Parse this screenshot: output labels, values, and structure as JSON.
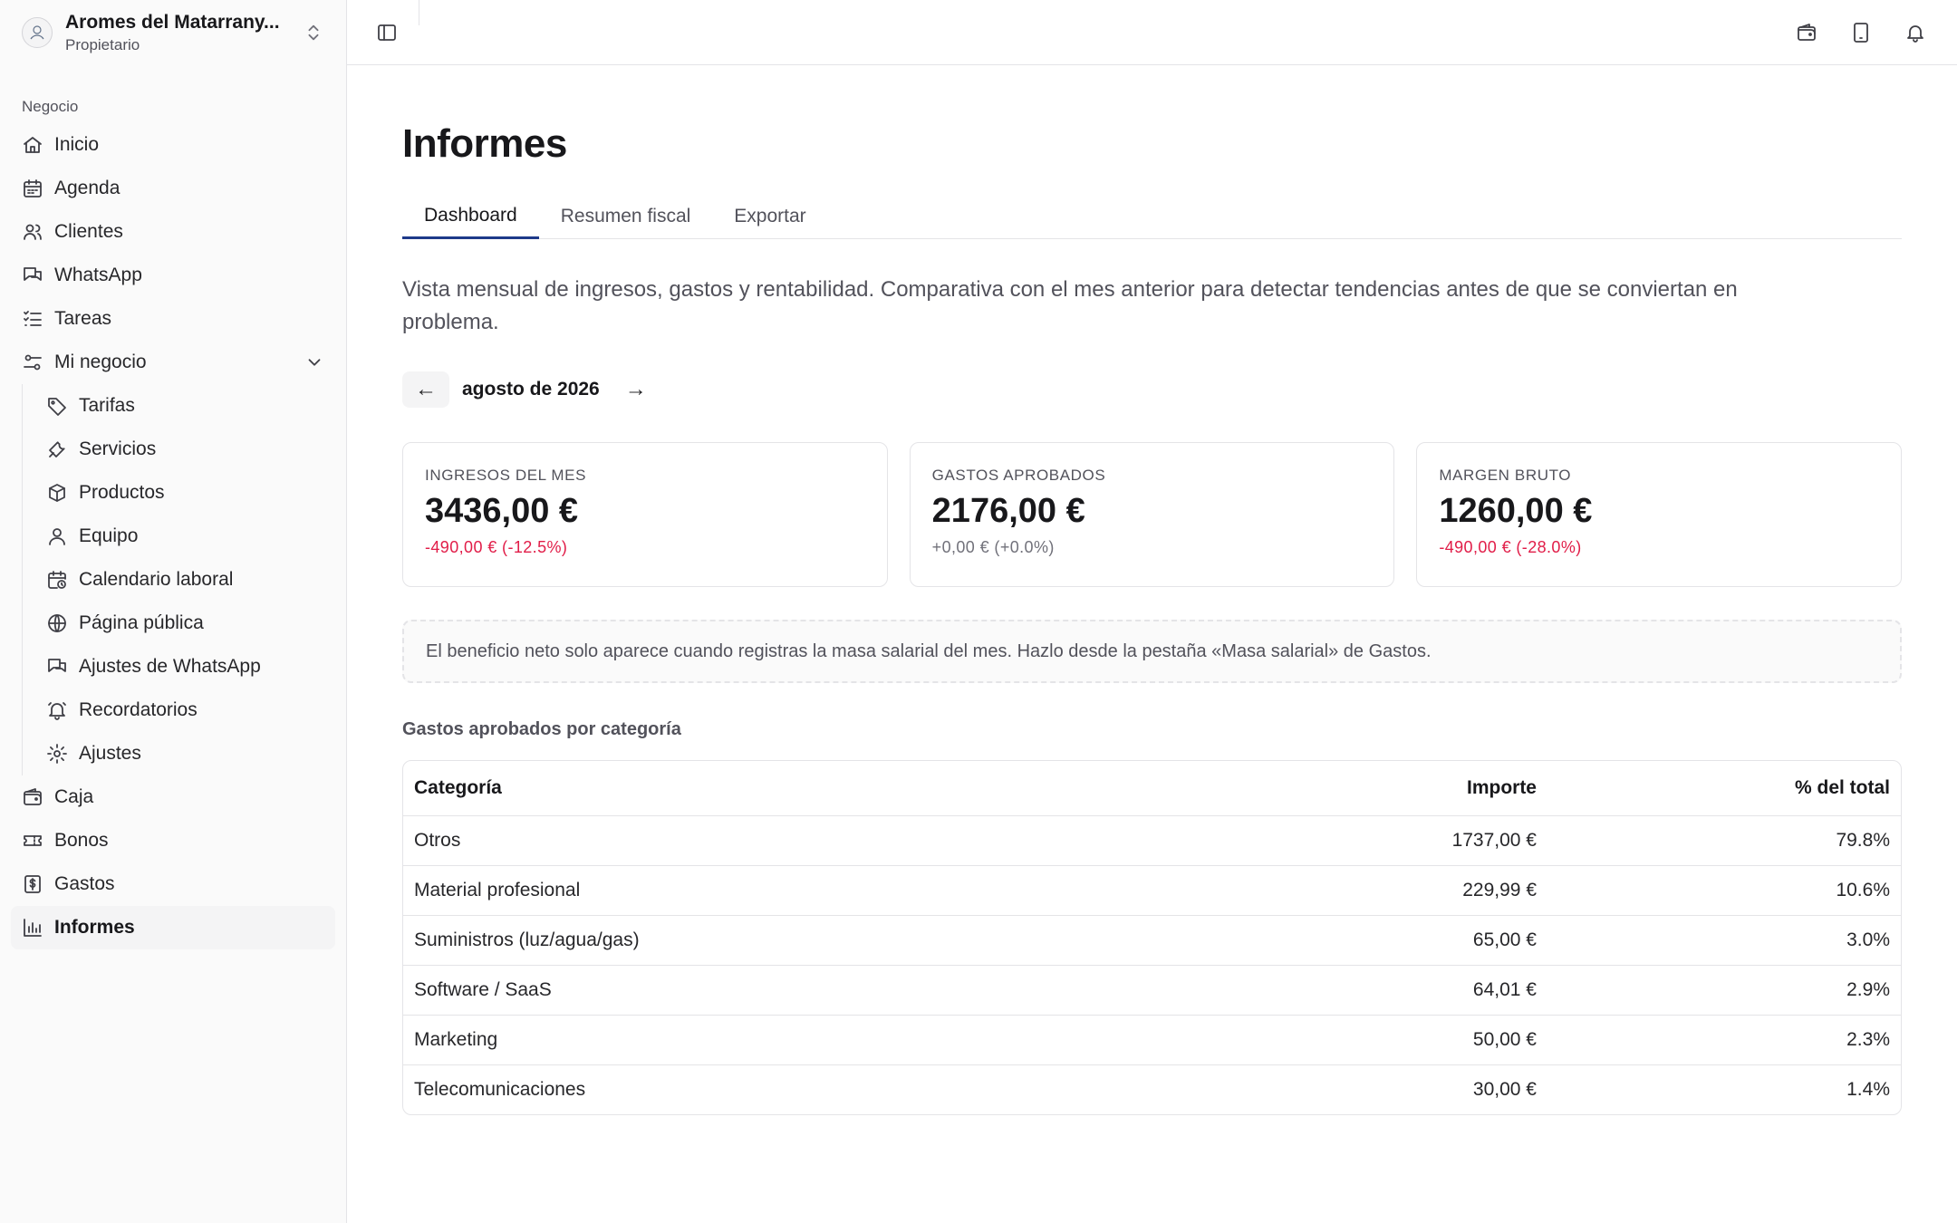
{
  "org": {
    "name": "Aromes del Matarrany...",
    "role": "Propietario"
  },
  "sidebar": {
    "section": "Negocio",
    "items": [
      {
        "label": "Inicio",
        "icon": "home-icon"
      },
      {
        "label": "Agenda",
        "icon": "calendar-icon"
      },
      {
        "label": "Clientes",
        "icon": "users-icon"
      },
      {
        "label": "WhatsApp",
        "icon": "chat-icon"
      },
      {
        "label": "Tareas",
        "icon": "list-icon"
      },
      {
        "label": "Mi negocio",
        "icon": "sliders-icon",
        "expanded": true
      }
    ],
    "subitems": [
      {
        "label": "Tarifas",
        "icon": "tag-icon"
      },
      {
        "label": "Servicios",
        "icon": "wrench-icon"
      },
      {
        "label": "Productos",
        "icon": "box-icon"
      },
      {
        "label": "Equipo",
        "icon": "user-icon"
      },
      {
        "label": "Calendario laboral",
        "icon": "calendar-clock-icon"
      },
      {
        "label": "Página pública",
        "icon": "globe-icon"
      },
      {
        "label": "Ajustes de WhatsApp",
        "icon": "chat-icon"
      },
      {
        "label": "Recordatorios",
        "icon": "bell-ring-icon"
      },
      {
        "label": "Ajustes",
        "icon": "gear-icon"
      }
    ],
    "bottom_items": [
      {
        "label": "Caja",
        "icon": "wallet-icon"
      },
      {
        "label": "Bonos",
        "icon": "ticket-icon"
      },
      {
        "label": "Gastos",
        "icon": "receipt-icon"
      },
      {
        "label": "Informes",
        "icon": "bar-chart-icon",
        "active": true
      }
    ]
  },
  "topbar": {
    "icons": [
      "wallet-icon",
      "tablet-icon",
      "bell-icon"
    ]
  },
  "page": {
    "title": "Informes",
    "tabs": [
      {
        "label": "Dashboard",
        "active": true
      },
      {
        "label": "Resumen fiscal"
      },
      {
        "label": "Exportar"
      }
    ],
    "description": "Vista mensual de ingresos, gastos y rentabilidad. Comparativa con el mes anterior para detectar tendencias antes de que se conviertan en problema.",
    "month": {
      "label": "agosto de 2026",
      "prev": "←",
      "next": "→"
    },
    "kpis": [
      {
        "label": "INGRESOS DEL MES",
        "value": "3436,00 €",
        "delta": "-490,00 € (-12.5%)",
        "trend": "negative"
      },
      {
        "label": "GASTOS APROBADOS",
        "value": "2176,00 €",
        "delta": "+0,00 € (+0.0%)",
        "trend": "neutral"
      },
      {
        "label": "MARGEN BRUTO",
        "value": "1260,00 €",
        "delta": "-490,00 € (-28.0%)",
        "trend": "negative"
      }
    ],
    "note": "El beneficio neto solo aparece cuando registras la masa salarial del mes. Hazlo desde la pestaña «Masa salarial» de Gastos.",
    "table": {
      "title": "Gastos aprobados por categoría",
      "columns": [
        "Categoría",
        "Importe",
        "% del total"
      ],
      "rows": [
        {
          "category": "Otros",
          "amount": "1737,00 €",
          "percent": "79.8%"
        },
        {
          "category": "Material profesional",
          "amount": "229,99 €",
          "percent": "10.6%"
        },
        {
          "category": "Suministros (luz/agua/gas)",
          "amount": "65,00 €",
          "percent": "3.0%"
        },
        {
          "category": "Software / SaaS",
          "amount": "64,01 €",
          "percent": "2.9%"
        },
        {
          "category": "Marketing",
          "amount": "50,00 €",
          "percent": "2.3%"
        },
        {
          "category": "Telecomunicaciones",
          "amount": "30,00 €",
          "percent": "1.4%"
        }
      ]
    }
  },
  "colors": {
    "accent": "#1e3a8a",
    "negative": "#e11d48",
    "border": "#e4e4e7",
    "sidebar_bg": "#fafafa"
  }
}
